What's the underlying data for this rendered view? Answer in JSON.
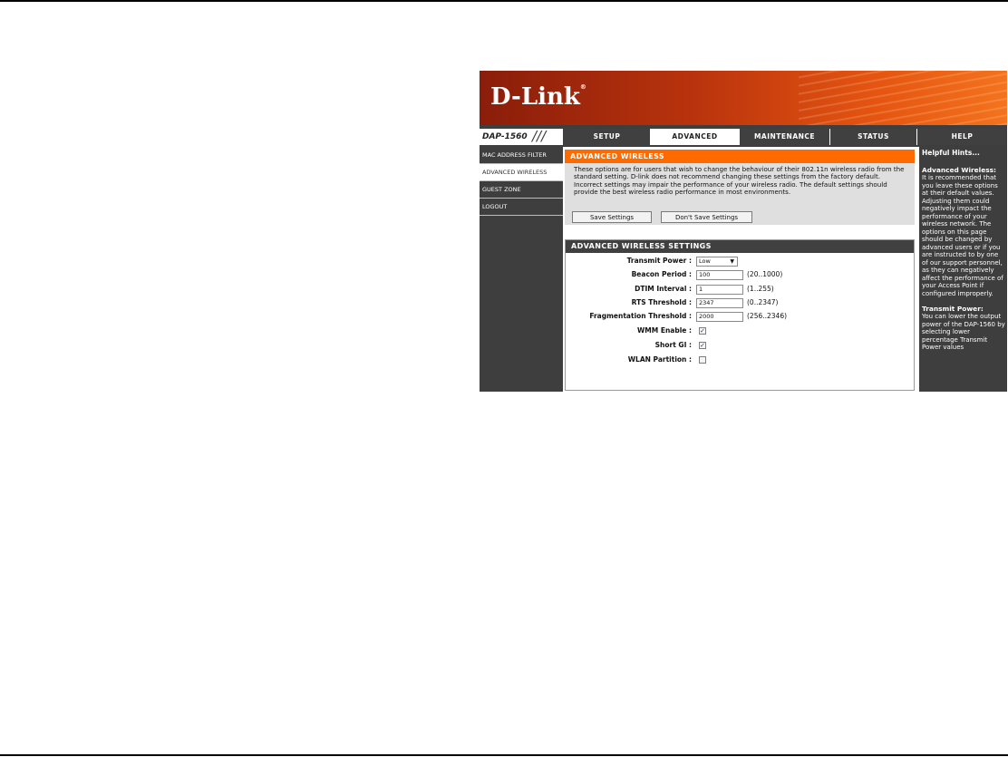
{
  "brand": {
    "logo": "D-Link",
    "registered_mark": "®",
    "model": "DAP-1560"
  },
  "tabs": [
    {
      "label": "SETUP"
    },
    {
      "label": "ADVANCED"
    },
    {
      "label": "MAINTENANCE"
    },
    {
      "label": "STATUS"
    },
    {
      "label": "HELP"
    }
  ],
  "active_tab": "ADVANCED",
  "sidebar": {
    "items": [
      {
        "label": "MAC ADDRESS FILTER"
      },
      {
        "label": "ADVANCED WIRELESS"
      },
      {
        "label": "GUEST ZONE"
      },
      {
        "label": "LOGOUT"
      }
    ],
    "active": "ADVANCED WIRELESS"
  },
  "advanced_wireless": {
    "title": "ADVANCED WIRELESS",
    "description": "These options are for users that wish to change the behaviour of their 802.11n wireless radio from the standard setting. D-link does not recommend changing these settings from the factory default. Incorrect settings may impair the performance of your wireless radio. The default settings should provide the best wireless radio performance in most environments.",
    "save_button": "Save Settings",
    "dont_save_button": "Don't Save Settings"
  },
  "settings": {
    "title": "ADVANCED WIRELESS SETTINGS",
    "transmit_power": {
      "label": "Transmit Power :",
      "value": "Low"
    },
    "beacon_period": {
      "label": "Beacon Period :",
      "value": "100",
      "range": "(20..1000)"
    },
    "dtim_interval": {
      "label": "DTIM Interval :",
      "value": "1",
      "range": "(1..255)"
    },
    "rts_threshold": {
      "label": "RTS Threshold :",
      "value": "2347",
      "range": "(0..2347)"
    },
    "fragmentation_threshold": {
      "label": "Fragmentation Threshold :",
      "value": "2000",
      "range": "(256..2346)"
    },
    "wmm_enable": {
      "label": "WMM Enable :",
      "checked": true,
      "mark": "✓"
    },
    "short_gi": {
      "label": "Short GI :",
      "checked": true,
      "mark": "✓"
    },
    "wlan_partition": {
      "label": "WLAN Partition :",
      "checked": false,
      "mark": ""
    }
  },
  "help": {
    "title": "Helpful Hints...",
    "sections": [
      {
        "heading": "Advanced Wireless:",
        "text": "It is recommended that you leave these options at their default values. Adjusting them could negatively impact the performance of your wireless network. The options on this page should be changed by advanced users or if you are instructed to by one of our support personnel, as they can negatively affect the performance of your Access Point if configured improperly."
      },
      {
        "heading": "Transmit Power:",
        "text": "You can lower the output power of the DAP-1560 by selecting lower percentage Transmit Power values"
      }
    ]
  },
  "colors": {
    "banner_orange": "#f4731d",
    "banner_red": "#8a1d0a",
    "section_orange": "#ff6a00",
    "dark_gray": "#3e3e3e"
  }
}
